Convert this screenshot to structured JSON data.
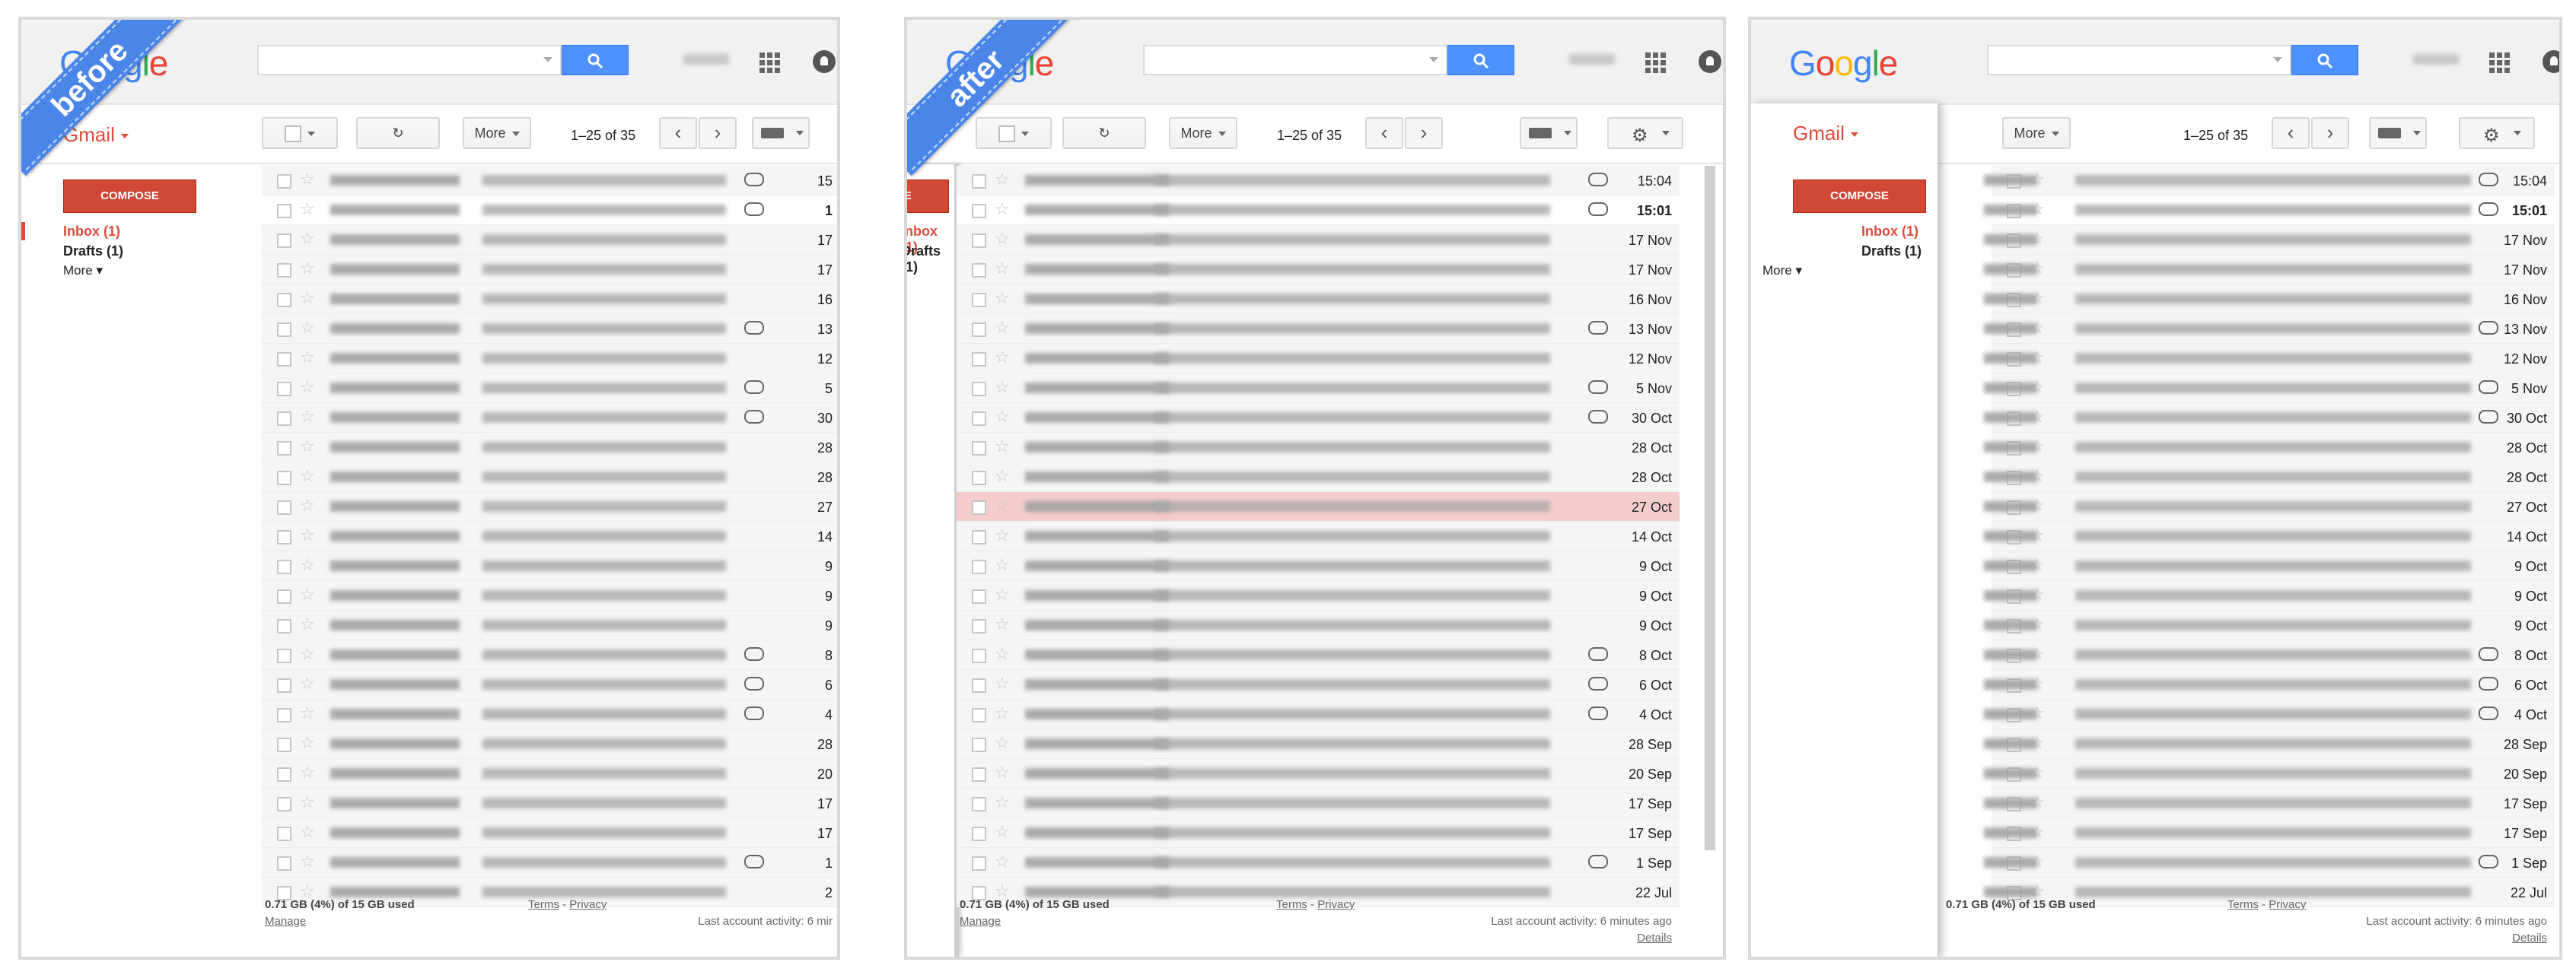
{
  "labels": {
    "before": "before",
    "after": "after"
  },
  "app": {
    "logo": "Google",
    "gmail": "Gmail"
  },
  "toolbar": {
    "more": "More",
    "count": "1–25 of 35"
  },
  "sidebar": {
    "compose": "COMPOSE",
    "inbox": "Inbox (1)",
    "drafts": "Drafts (1)",
    "more": "More"
  },
  "footer": {
    "quota": "0.71 GB (4%) of 15 GB used",
    "manage": "Manage",
    "terms": "Terms",
    "sep": " - ",
    "privacy": "Privacy",
    "activity": "Last account activity: 6 minutes ago",
    "details": "Details"
  },
  "emails": [
    {
      "date": "15:04",
      "unread": false,
      "attach": true
    },
    {
      "date": "15:01",
      "unread": true,
      "attach": true
    },
    {
      "date": "17 Nov",
      "unread": false,
      "attach": false
    },
    {
      "date": "17 Nov",
      "unread": false,
      "attach": false
    },
    {
      "date": "16 Nov",
      "unread": false,
      "attach": false
    },
    {
      "date": "13 Nov",
      "unread": false,
      "attach": true
    },
    {
      "date": "12 Nov",
      "unread": false,
      "attach": false
    },
    {
      "date": "5 Nov",
      "unread": false,
      "attach": true
    },
    {
      "date": "30 Oct",
      "unread": false,
      "attach": true
    },
    {
      "date": "28 Oct",
      "unread": false,
      "attach": false
    },
    {
      "date": "28 Oct",
      "unread": false,
      "attach": false
    },
    {
      "date": "27 Oct",
      "unread": false,
      "attach": false
    },
    {
      "date": "14 Oct",
      "unread": false,
      "attach": false
    },
    {
      "date": "9 Oct",
      "unread": false,
      "attach": false
    },
    {
      "date": "9 Oct",
      "unread": false,
      "attach": false
    },
    {
      "date": "9 Oct",
      "unread": false,
      "attach": false
    },
    {
      "date": "8 Oct",
      "unread": false,
      "attach": true
    },
    {
      "date": "6 Oct",
      "unread": false,
      "attach": true
    },
    {
      "date": "4 Oct",
      "unread": false,
      "attach": true
    },
    {
      "date": "28 Sep",
      "unread": false,
      "attach": false
    },
    {
      "date": "20 Sep",
      "unread": false,
      "attach": false
    },
    {
      "date": "17 Sep",
      "unread": false,
      "attach": false
    },
    {
      "date": "17 Sep",
      "unread": false,
      "attach": false
    },
    {
      "date": "1 Sep",
      "unread": false,
      "attach": true
    },
    {
      "date": "22 Jul",
      "unread": false,
      "attach": false
    }
  ],
  "before_dates": [
    "15",
    "1",
    "17",
    "17",
    "16",
    "13",
    "12",
    "5",
    "30",
    "28",
    "28",
    "27",
    "14",
    "9",
    "9",
    "9",
    "8",
    "6",
    "4",
    "28",
    "20",
    "17",
    "17",
    "1",
    "2"
  ],
  "before_activity": "Last account activity: 6 mir",
  "highlight_row_index": 11,
  "colors": {
    "accent": "#dd4b39",
    "search": "#4d90fe",
    "ribbon": "#4a86e8",
    "highlight": "#f4cccc"
  }
}
